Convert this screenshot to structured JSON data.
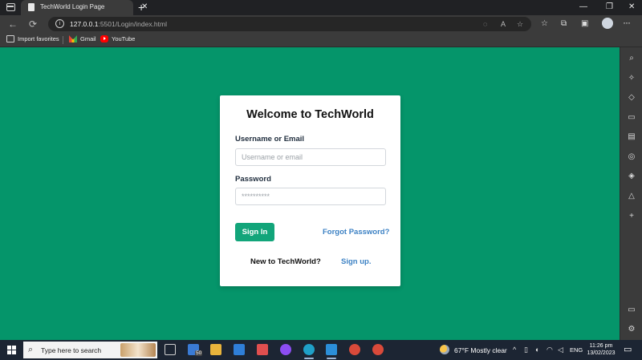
{
  "browser": {
    "tab_title": "TechWorld Login Page",
    "tab_close": "✕",
    "new_tab": "+",
    "url_host": "127.0.0.1",
    "url_path": ":5501/Login/index.html",
    "icons": [
      "tabs-icon",
      "page-icon",
      "close-icon",
      "new-tab-icon",
      "minimize-icon",
      "restore-icon",
      "window-close-icon",
      "back-icon",
      "refresh-icon",
      "info-icon",
      "translate-icon",
      "read-aloud-icon",
      "add-favorite-icon",
      "favorites-icon",
      "collections-icon",
      "extensions-icon",
      "profile-icon",
      "more-icon"
    ],
    "window_controls": {
      "minimize": "—",
      "restore": "❐",
      "close": "✕"
    },
    "nav": {
      "back": "←",
      "refresh": "⟳"
    }
  },
  "favorites": [
    {
      "label": "Import favorites",
      "icon": "import-icon"
    },
    {
      "label": "Gmail",
      "icon": "gmail-icon"
    },
    {
      "label": "YouTube",
      "icon": "youtube-icon"
    }
  ],
  "login": {
    "title": "Welcome to TechWorld",
    "username_label": "Username or Email",
    "username_placeholder": "Username or email",
    "password_label": "Password",
    "password_value": "**********",
    "signin_label": "Sign In",
    "forgot_label": "Forgot Password?",
    "new_label": "New to TechWorld?",
    "signup_label": "Sign up."
  },
  "sidebar_icons": [
    "search-icon",
    "sparkle-icon",
    "tag-icon",
    "tools-icon",
    "office-icon",
    "outlook-icon",
    "games-icon",
    "bell-icon",
    "add-icon",
    "split-icon",
    "settings-icon"
  ],
  "taskbar": {
    "search_placeholder": "Type here to search",
    "badge": "50",
    "weather": "67°F  Mostly clear",
    "language": "ENG",
    "time": "11:26 pm",
    "date": "13/02/2023"
  },
  "colors": {
    "page_background": "#05956a",
    "signin_button": "#12a57a",
    "link": "#3d82c4"
  }
}
